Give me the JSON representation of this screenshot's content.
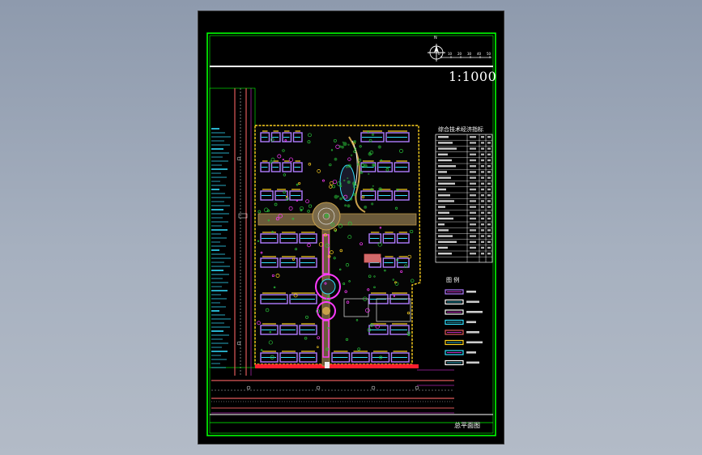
{
  "scale": "1:1000",
  "north_label": "N",
  "scale_bar_numbers": [
    "0",
    "10",
    "20",
    "30",
    "40",
    "50"
  ],
  "sheet_title": "总平面图",
  "table_title": "综合技术经济指标",
  "legend_title": "图 例",
  "colors": {
    "sheet_bg": "#000000",
    "frame": "#00ff00",
    "white": "#ffffff",
    "building": "#b07cff",
    "road": "#e05a5a",
    "plaza": "#c8a04a",
    "green": "#29c23a",
    "cyan": "#33e0ff",
    "magenta": "#ff3bff",
    "yellow": "#ffd21f"
  }
}
